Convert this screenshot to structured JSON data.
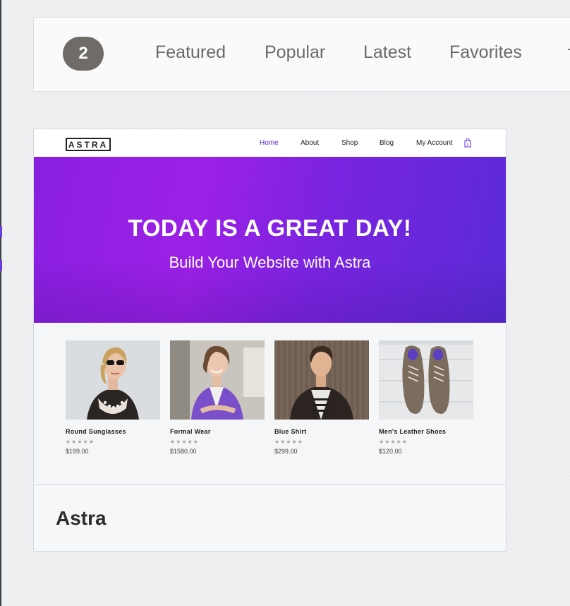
{
  "filter_bar": {
    "count": "2",
    "tabs": [
      {
        "label": "Featured"
      },
      {
        "label": "Popular"
      },
      {
        "label": "Latest"
      },
      {
        "label": "Favorites"
      }
    ]
  },
  "theme_card": {
    "name": "Astra",
    "preview": {
      "logo": "ASTRA",
      "nav": [
        "Home",
        "About",
        "Shop",
        "Blog",
        "My Account"
      ],
      "hero_title": "TODAY IS A GREAT DAY!",
      "hero_subtitle": "Build Your Website with Astra",
      "products": [
        {
          "name": "Round Sunglasses",
          "rating": "★★★★★",
          "price": "$199.00"
        },
        {
          "name": "Formal Wear",
          "rating": "★★★★★",
          "price": "$1580.00"
        },
        {
          "name": "Blue Shirt",
          "rating": "★★★★★",
          "price": "$299.00"
        },
        {
          "name": "Men's Leather Shoes",
          "rating": "★★★★★",
          "price": "$120.00"
        }
      ]
    }
  },
  "colors": {
    "accent": "#5b2bd6",
    "hero_start": "#8a1fe0",
    "hero_end": "#5a2bd6",
    "badge": "#6f6c68"
  }
}
